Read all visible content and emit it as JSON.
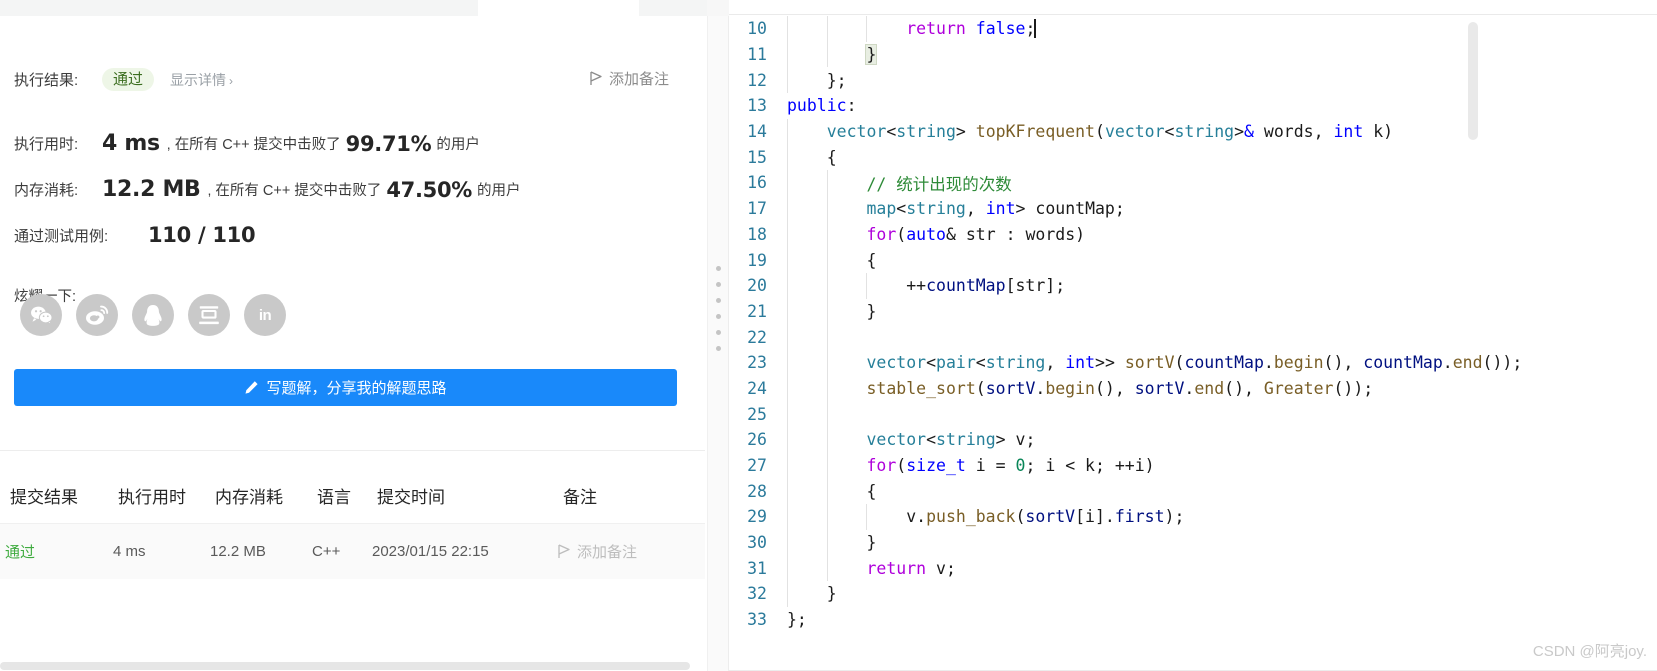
{
  "result_panel": {
    "result_label": "执行结果:",
    "result_status": "通过",
    "show_detail": "显示详情",
    "chevron": "›",
    "add_note": "添加备注",
    "runtime_label": "执行用时:",
    "runtime_value": "4 ms",
    "runtime_comma": ",",
    "runtime_text_before": "在所有 C++ 提交中击败了",
    "runtime_percent": "99.71%",
    "runtime_text_after": "的用户",
    "memory_label": "内存消耗:",
    "memory_value": "12.2 MB",
    "memory_comma": ",",
    "memory_text_before": "在所有 C++ 提交中击败了",
    "memory_percent": "47.50%",
    "memory_text_after": "的用户",
    "testcases_label": "通过测试用例:",
    "testcases_value": "110 / 110",
    "share_label": "炫耀一下:",
    "share_icons": [
      {
        "name": "wechat-icon",
        "title": "微信"
      },
      {
        "name": "weibo-icon",
        "title": "微博"
      },
      {
        "name": "qq-icon",
        "title": "QQ"
      },
      {
        "name": "douban-icon",
        "title": "豆瓣"
      },
      {
        "name": "linkedin-icon",
        "title": "in"
      }
    ],
    "cta_label": "写题解，分享我的解题思路",
    "cta_color": "#1989fa",
    "pass_badge_bg": "#eef6e7",
    "pass_badge_fg": "#3c6e20"
  },
  "submissions_table": {
    "headers": [
      "提交结果",
      "执行用时",
      "内存消耗",
      "语言",
      "提交时间",
      "备注"
    ],
    "rows": [
      {
        "status": "通过",
        "runtime": "4 ms",
        "memory": "12.2 MB",
        "language": "C++",
        "time": "2023/01/15 22:15",
        "note": "添加备注"
      }
    ],
    "pass_color": "#3fab3f"
  },
  "editor": {
    "first_line_number": 10,
    "lines": [
      {
        "n": 10,
        "indent": 3,
        "guides": [
          1,
          2,
          3
        ],
        "tokens": [
          {
            "t": "            ",
            "c": "k-pl"
          },
          {
            "t": "return",
            "c": "k-kw"
          },
          {
            "t": " ",
            "c": "k-pl"
          },
          {
            "t": "false",
            "c": "k-type"
          },
          {
            "t": ";",
            "c": "k-pl"
          }
        ],
        "caret": true
      },
      {
        "n": 11,
        "indent": 2,
        "guides": [
          1,
          2
        ],
        "tokens": [
          {
            "t": "        ",
            "c": "k-pl"
          },
          {
            "t": "}",
            "c": "k-pl",
            "hl": true
          }
        ]
      },
      {
        "n": 12,
        "indent": 1,
        "guides": [
          1
        ],
        "tokens": [
          {
            "t": "    };",
            "c": "k-pl"
          }
        ]
      },
      {
        "n": 13,
        "indent": 0,
        "guides": [],
        "tokens": [
          {
            "t": "public",
            "c": "k-type"
          },
          {
            "t": ":",
            "c": "k-pl"
          }
        ]
      },
      {
        "n": 14,
        "indent": 1,
        "guides": [
          1
        ],
        "tokens": [
          {
            "t": "    ",
            "c": "k-pl"
          },
          {
            "t": "vector",
            "c": "k-cls"
          },
          {
            "t": "<",
            "c": "k-pl"
          },
          {
            "t": "string",
            "c": "k-cls"
          },
          {
            "t": "> ",
            "c": "k-pl"
          },
          {
            "t": "topKFrequent",
            "c": "k-fn"
          },
          {
            "t": "(",
            "c": "k-pl"
          },
          {
            "t": "vector",
            "c": "k-cls"
          },
          {
            "t": "<",
            "c": "k-pl"
          },
          {
            "t": "string",
            "c": "k-cls"
          },
          {
            "t": ">",
            "c": "k-pl"
          },
          {
            "t": "&",
            "c": "k-type"
          },
          {
            "t": " words, ",
            "c": "k-pl"
          },
          {
            "t": "int",
            "c": "k-type"
          },
          {
            "t": " k)",
            "c": "k-pl"
          }
        ]
      },
      {
        "n": 15,
        "indent": 1,
        "guides": [
          1
        ],
        "tokens": [
          {
            "t": "    {",
            "c": "k-pl"
          }
        ]
      },
      {
        "n": 16,
        "indent": 2,
        "guides": [
          1,
          2
        ],
        "tokens": [
          {
            "t": "        ",
            "c": "k-pl"
          },
          {
            "t": "// 统计出现的次数",
            "c": "k-cmt"
          }
        ]
      },
      {
        "n": 17,
        "indent": 2,
        "guides": [
          1,
          2
        ],
        "tokens": [
          {
            "t": "        ",
            "c": "k-pl"
          },
          {
            "t": "map",
            "c": "k-cls"
          },
          {
            "t": "<",
            "c": "k-pl"
          },
          {
            "t": "string",
            "c": "k-cls"
          },
          {
            "t": ", ",
            "c": "k-pl"
          },
          {
            "t": "int",
            "c": "k-type"
          },
          {
            "t": "> countMap;",
            "c": "k-pl"
          }
        ]
      },
      {
        "n": 18,
        "indent": 2,
        "guides": [
          1,
          2
        ],
        "tokens": [
          {
            "t": "        ",
            "c": "k-pl"
          },
          {
            "t": "for",
            "c": "k-kw"
          },
          {
            "t": "(",
            "c": "k-pl"
          },
          {
            "t": "auto",
            "c": "k-type"
          },
          {
            "t": "& str : words)",
            "c": "k-pl"
          }
        ]
      },
      {
        "n": 19,
        "indent": 2,
        "guides": [
          1,
          2
        ],
        "tokens": [
          {
            "t": "        {",
            "c": "k-pl"
          }
        ]
      },
      {
        "n": 20,
        "indent": 3,
        "guides": [
          1,
          2,
          3
        ],
        "tokens": [
          {
            "t": "            ++",
            "c": "k-pl"
          },
          {
            "t": "countMap",
            "c": "k-var"
          },
          {
            "t": "[str];",
            "c": "k-pl"
          }
        ]
      },
      {
        "n": 21,
        "indent": 2,
        "guides": [
          1,
          2
        ],
        "tokens": [
          {
            "t": "        }",
            "c": "k-pl"
          }
        ]
      },
      {
        "n": 22,
        "indent": 2,
        "guides": [
          1,
          2
        ],
        "tokens": []
      },
      {
        "n": 23,
        "indent": 2,
        "guides": [
          1,
          2
        ],
        "tokens": [
          {
            "t": "        ",
            "c": "k-pl"
          },
          {
            "t": "vector",
            "c": "k-cls"
          },
          {
            "t": "<",
            "c": "k-pl"
          },
          {
            "t": "pair",
            "c": "k-cls"
          },
          {
            "t": "<",
            "c": "k-pl"
          },
          {
            "t": "string",
            "c": "k-cls"
          },
          {
            "t": ", ",
            "c": "k-pl"
          },
          {
            "t": "int",
            "c": "k-type"
          },
          {
            "t": ">> ",
            "c": "k-pl"
          },
          {
            "t": "sortV",
            "c": "k-fn"
          },
          {
            "t": "(",
            "c": "k-pl"
          },
          {
            "t": "countMap",
            "c": "k-var"
          },
          {
            "t": ".",
            "c": "k-pl"
          },
          {
            "t": "begin",
            "c": "k-fn"
          },
          {
            "t": "(), ",
            "c": "k-pl"
          },
          {
            "t": "countMap",
            "c": "k-var"
          },
          {
            "t": ".",
            "c": "k-pl"
          },
          {
            "t": "end",
            "c": "k-fn"
          },
          {
            "t": "());",
            "c": "k-pl"
          }
        ]
      },
      {
        "n": 24,
        "indent": 2,
        "guides": [
          1,
          2
        ],
        "tokens": [
          {
            "t": "        ",
            "c": "k-pl"
          },
          {
            "t": "stable_sort",
            "c": "k-fn"
          },
          {
            "t": "(",
            "c": "k-pl"
          },
          {
            "t": "sortV",
            "c": "k-var"
          },
          {
            "t": ".",
            "c": "k-pl"
          },
          {
            "t": "begin",
            "c": "k-fn"
          },
          {
            "t": "(), ",
            "c": "k-pl"
          },
          {
            "t": "sortV",
            "c": "k-var"
          },
          {
            "t": ".",
            "c": "k-pl"
          },
          {
            "t": "end",
            "c": "k-fn"
          },
          {
            "t": "(), ",
            "c": "k-pl"
          },
          {
            "t": "Greater",
            "c": "k-fn"
          },
          {
            "t": "());",
            "c": "k-pl"
          }
        ]
      },
      {
        "n": 25,
        "indent": 2,
        "guides": [
          1,
          2
        ],
        "tokens": []
      },
      {
        "n": 26,
        "indent": 2,
        "guides": [
          1,
          2
        ],
        "tokens": [
          {
            "t": "        ",
            "c": "k-pl"
          },
          {
            "t": "vector",
            "c": "k-cls"
          },
          {
            "t": "<",
            "c": "k-pl"
          },
          {
            "t": "string",
            "c": "k-cls"
          },
          {
            "t": "> v;",
            "c": "k-pl"
          }
        ]
      },
      {
        "n": 27,
        "indent": 2,
        "guides": [
          1,
          2
        ],
        "tokens": [
          {
            "t": "        ",
            "c": "k-pl"
          },
          {
            "t": "for",
            "c": "k-kw"
          },
          {
            "t": "(",
            "c": "k-pl"
          },
          {
            "t": "size_t",
            "c": "k-type"
          },
          {
            "t": " i = ",
            "c": "k-pl"
          },
          {
            "t": "0",
            "c": "k-num"
          },
          {
            "t": "; i < k; ++i)",
            "c": "k-pl"
          }
        ]
      },
      {
        "n": 28,
        "indent": 2,
        "guides": [
          1,
          2
        ],
        "tokens": [
          {
            "t": "        {",
            "c": "k-pl"
          }
        ]
      },
      {
        "n": 29,
        "indent": 3,
        "guides": [
          1,
          2,
          3
        ],
        "tokens": [
          {
            "t": "            v.",
            "c": "k-pl"
          },
          {
            "t": "push_back",
            "c": "k-fn"
          },
          {
            "t": "(",
            "c": "k-pl"
          },
          {
            "t": "sortV",
            "c": "k-var"
          },
          {
            "t": "[i].",
            "c": "k-pl"
          },
          {
            "t": "first",
            "c": "k-var"
          },
          {
            "t": ");",
            "c": "k-pl"
          }
        ]
      },
      {
        "n": 30,
        "indent": 2,
        "guides": [
          1,
          2
        ],
        "tokens": [
          {
            "t": "        }",
            "c": "k-pl"
          }
        ]
      },
      {
        "n": 31,
        "indent": 2,
        "guides": [
          1,
          2
        ],
        "tokens": [
          {
            "t": "        ",
            "c": "k-pl"
          },
          {
            "t": "return",
            "c": "k-kw"
          },
          {
            "t": " v;",
            "c": "k-pl"
          }
        ]
      },
      {
        "n": 32,
        "indent": 1,
        "guides": [
          1
        ],
        "tokens": [
          {
            "t": "    }",
            "c": "k-pl"
          }
        ]
      },
      {
        "n": 33,
        "indent": 0,
        "guides": [],
        "tokens": [
          {
            "t": "};",
            "c": "k-pl"
          }
        ]
      }
    ]
  },
  "watermark": "CSDN @阿亮joy."
}
